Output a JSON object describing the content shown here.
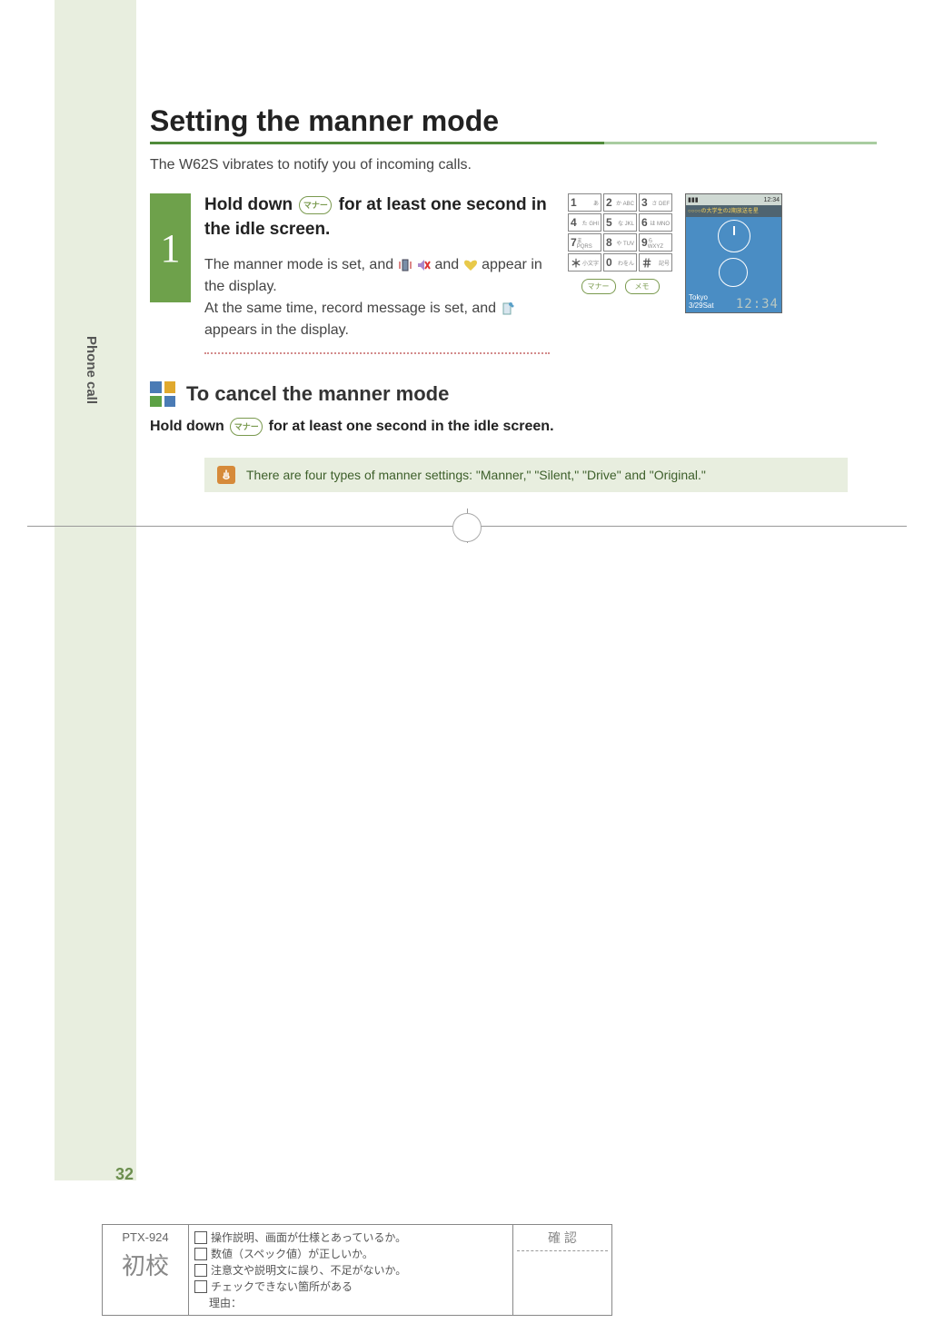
{
  "sideLabel": "Phone call",
  "pageNumber": "32",
  "title": "Setting the manner mode",
  "intro": "The W62S vibrates to notify you of incoming calls.",
  "step": {
    "num": "1",
    "headA": "Hold down ",
    "key": "マナー",
    "headB": " for at least one second in the idle screen.",
    "bodyA": "The manner mode is set, and ",
    "bodyB": " and ",
    "bodyC": " appear in the display.",
    "body2": "At the same time, record message is set, and ",
    "body3": " appears in the display."
  },
  "keypad": {
    "rows": [
      [
        "1",
        "あ",
        "2",
        "か ABC",
        "3",
        "さ DEF"
      ],
      [
        "4",
        "た GHI",
        "5",
        "な JKL",
        "6",
        "は MNO"
      ],
      [
        "7",
        "ま PQRS",
        "8",
        "や TUV",
        "9",
        "ら WXYZ"
      ],
      [
        "＊",
        "小文字",
        "0",
        "わをん",
        "＃",
        "記号"
      ]
    ],
    "fn1": "マナー",
    "fn2": "メモ"
  },
  "phoneScreen": {
    "statusLeft": "▮▮▮",
    "statusRight": "12:34",
    "banner": "○○○○の大学生の2期放送を星",
    "locLabel": "Tokyo",
    "dateLabel": "3/29Sat",
    "time": "12:34"
  },
  "subhead": "To cancel the manner mode",
  "subtextA": "Hold down ",
  "subtextKey": "マナー",
  "subtextB": " for at least one second in the idle screen.",
  "tip": "There are four types of manner settings: \"Manner,\" \"Silent,\" \"Drive\" and \"Original.\"",
  "proof": {
    "code": "PTX-924",
    "kanji": "初校",
    "items": [
      "操作説明、画面が仕様とあっているか。",
      "数値（スペック値）が正しいか。",
      "注意文や説明文に誤り、不足がないか。",
      "チェックできない箇所がある",
      "理由："
    ],
    "kakunin": "確 認"
  }
}
